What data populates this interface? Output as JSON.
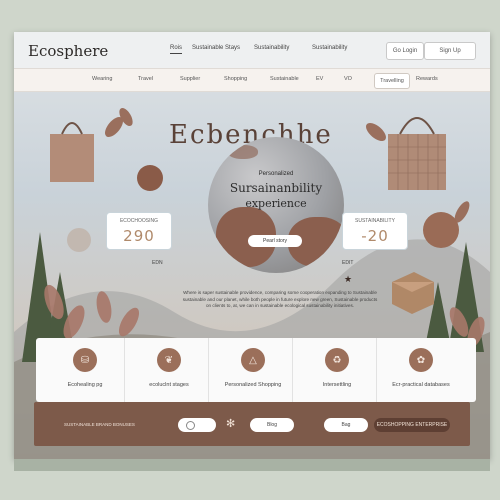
{
  "brand": "Ecosphere",
  "nav": {
    "links": [
      "Rois",
      "Sustainable Stays",
      "Sustainability",
      "Sustainability"
    ],
    "buttons": [
      "Go Login",
      "Sign Up"
    ]
  },
  "categories": {
    "items": [
      "Wearing",
      "Travel",
      "Supplier",
      "Shopping",
      "Sustainable",
      "EV",
      "VO",
      "Travelling",
      "Rewards"
    ]
  },
  "hero": {
    "title": "Ecbenchhe",
    "subtitle_small": "Personalized",
    "subtitle_line1": "Sursainanbility",
    "subtitle_line2": "experience",
    "button": "Pearl story"
  },
  "cards": {
    "left": {
      "label": "ECOCHOOSING",
      "value": "290"
    },
    "right": {
      "label": "SUSTAINABILITY",
      "value": "-20"
    }
  },
  "small_labels": {
    "left_mark": "EDN",
    "right_mark": "EDIT"
  },
  "description": "Where is saper sustainable providence, comparing some cooperation expanding to Sustainable sustainable and our planet, while both people in future explore new green, Sustainable products on clients to, at, we can in sustainable ecological sustainability initiatives.",
  "features": [
    {
      "icon": "pot-icon",
      "glyph": "⛁",
      "label": "Ecohealing pg"
    },
    {
      "icon": "leaf-circle-icon",
      "glyph": "❦",
      "label": "ecoluclnt stages"
    },
    {
      "icon": "triangle-icon",
      "glyph": "△",
      "label": "Personalized Shopping"
    },
    {
      "icon": "recycle-icon",
      "glyph": "♻",
      "label": "Intersettling"
    },
    {
      "icon": "gear-icon",
      "glyph": "✿",
      "label": "Ecr-practical databases"
    }
  ],
  "footer": {
    "left_text": "SUSTAINABLE BRAND BONUSES",
    "buttons": [
      "",
      "Blog",
      "Bag"
    ],
    "right_button": "ECOSHOPPING ENTERPRISE"
  },
  "colors": {
    "accent": "#7d5a4a",
    "brand_brown": "#9b6f5a",
    "card_value": "#b08a6b"
  }
}
